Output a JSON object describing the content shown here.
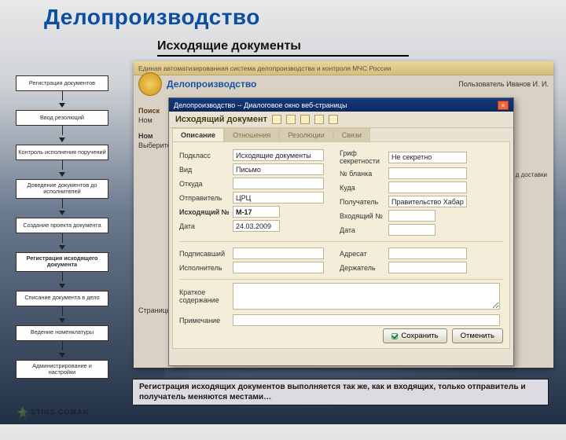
{
  "page": {
    "title": "Делопроизводство",
    "section_title": "Исходящие документы"
  },
  "sidebar": {
    "items": [
      {
        "label": "Регистрация документов",
        "active": false
      },
      {
        "label": "Ввод резолюций",
        "active": false
      },
      {
        "label": "Контроль исполнения поручений",
        "active": false
      },
      {
        "label": "Доведение документов до исполнителей",
        "active": false
      },
      {
        "label": "Создание проекта документа",
        "active": false
      },
      {
        "label": "Регистрация исходящего документа",
        "active": true
      },
      {
        "label": "Списание документа в дело",
        "active": false
      },
      {
        "label": "Ведение номенклатуры",
        "active": false
      },
      {
        "label": "Администрирование и настройки",
        "active": false
      }
    ]
  },
  "app": {
    "system_title": "Единая автоматизированная система делопроизводства и контроля МЧС России",
    "brand": "Делопроизводство",
    "user_label": "Пользователь",
    "user_name": "Иванов И. И.",
    "search_label": "Поиск",
    "search_field_label": "Ном",
    "rows_label": "Ном",
    "select_hint": "Выберите",
    "pages_label": "Страницы",
    "column_delivery": "д доставки"
  },
  "dialog": {
    "titlebar": "Делопроизводство -- Диалоговое окно веб-страницы",
    "heading": "Исходящий документ",
    "tabs": [
      "Описание",
      "Отношения",
      "Резолюции",
      "Связи"
    ],
    "active_tab": 0,
    "fields": {
      "subclass_label": "Подкласс",
      "subclass": "Исходящие документы",
      "secrecy_label": "Гриф секретности",
      "secrecy": "Не секретно",
      "kind_label": "Вид",
      "kind": "Письмо",
      "blank_label": "№ бланка",
      "blank": "",
      "from_label": "Откуда",
      "from": "",
      "to_label": "Куда",
      "to": "",
      "sender_label": "Отправитель",
      "sender": "ЦРЦ",
      "recipient_label": "Получатель",
      "recipient": "Правительство Хабарс",
      "outno_label": "Исходящий №",
      "outno": "М-17",
      "inno_label": "Входящий №",
      "inno": "",
      "date_label": "Дата",
      "date": "24.03.2009",
      "date2_label": "Дата",
      "date2": "",
      "signer_label": "Подписавший",
      "signer": "",
      "addressee_label": "Адресат",
      "addressee": "",
      "executor_label": "Исполнитель",
      "executor": "",
      "holder_label": "Держатель",
      "holder": "",
      "summary_label": "Краткое содержание",
      "summary": "",
      "note_label": "Примечание",
      "note": ""
    },
    "buttons": {
      "save": "Сохранить",
      "cancel": "Отменить"
    }
  },
  "description": "Регистрация исходящих документов выполняется так же, как и входящих, только отправитель и получатель меняются местами…",
  "footer_logo": "STINS  COMAN"
}
